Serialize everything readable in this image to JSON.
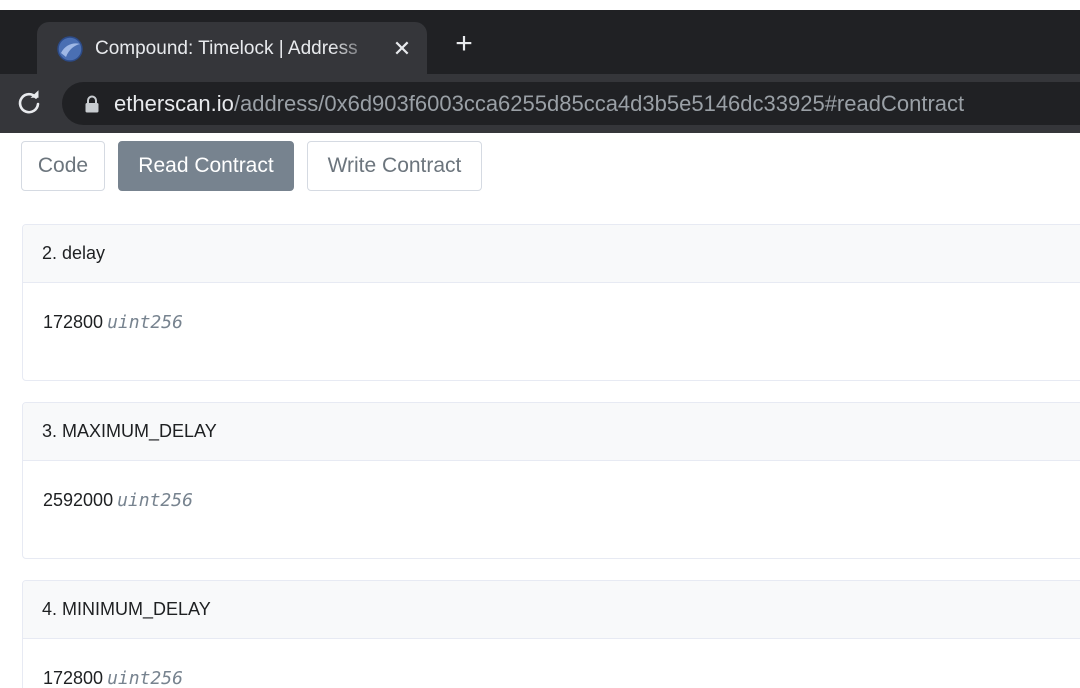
{
  "browser": {
    "tab": {
      "title": "Compound: Timelock | Address",
      "close_glyph": "✕",
      "favicon": "compound-logo-icon"
    },
    "new_tab_glyph": "+",
    "address_bar": {
      "host": "etherscan.io",
      "path": "/address/0x6d903f6003cca6255d85cca4d3b5e5146dc33925#readContract"
    }
  },
  "contract_tabs": {
    "code": "Code",
    "read": "Read Contract",
    "write": "Write Contract",
    "active": "read"
  },
  "functions": [
    {
      "header": "2. delay",
      "value": "172800",
      "type": "uint256"
    },
    {
      "header": "3. MAXIMUM_DELAY",
      "value": "2592000",
      "type": "uint256"
    },
    {
      "header": "4. MINIMUM_DELAY",
      "value": "172800",
      "type": "uint256"
    }
  ],
  "colors": {
    "tabstrip": "#202124",
    "active_tab": "#35363a",
    "active_button": "#77838f"
  }
}
